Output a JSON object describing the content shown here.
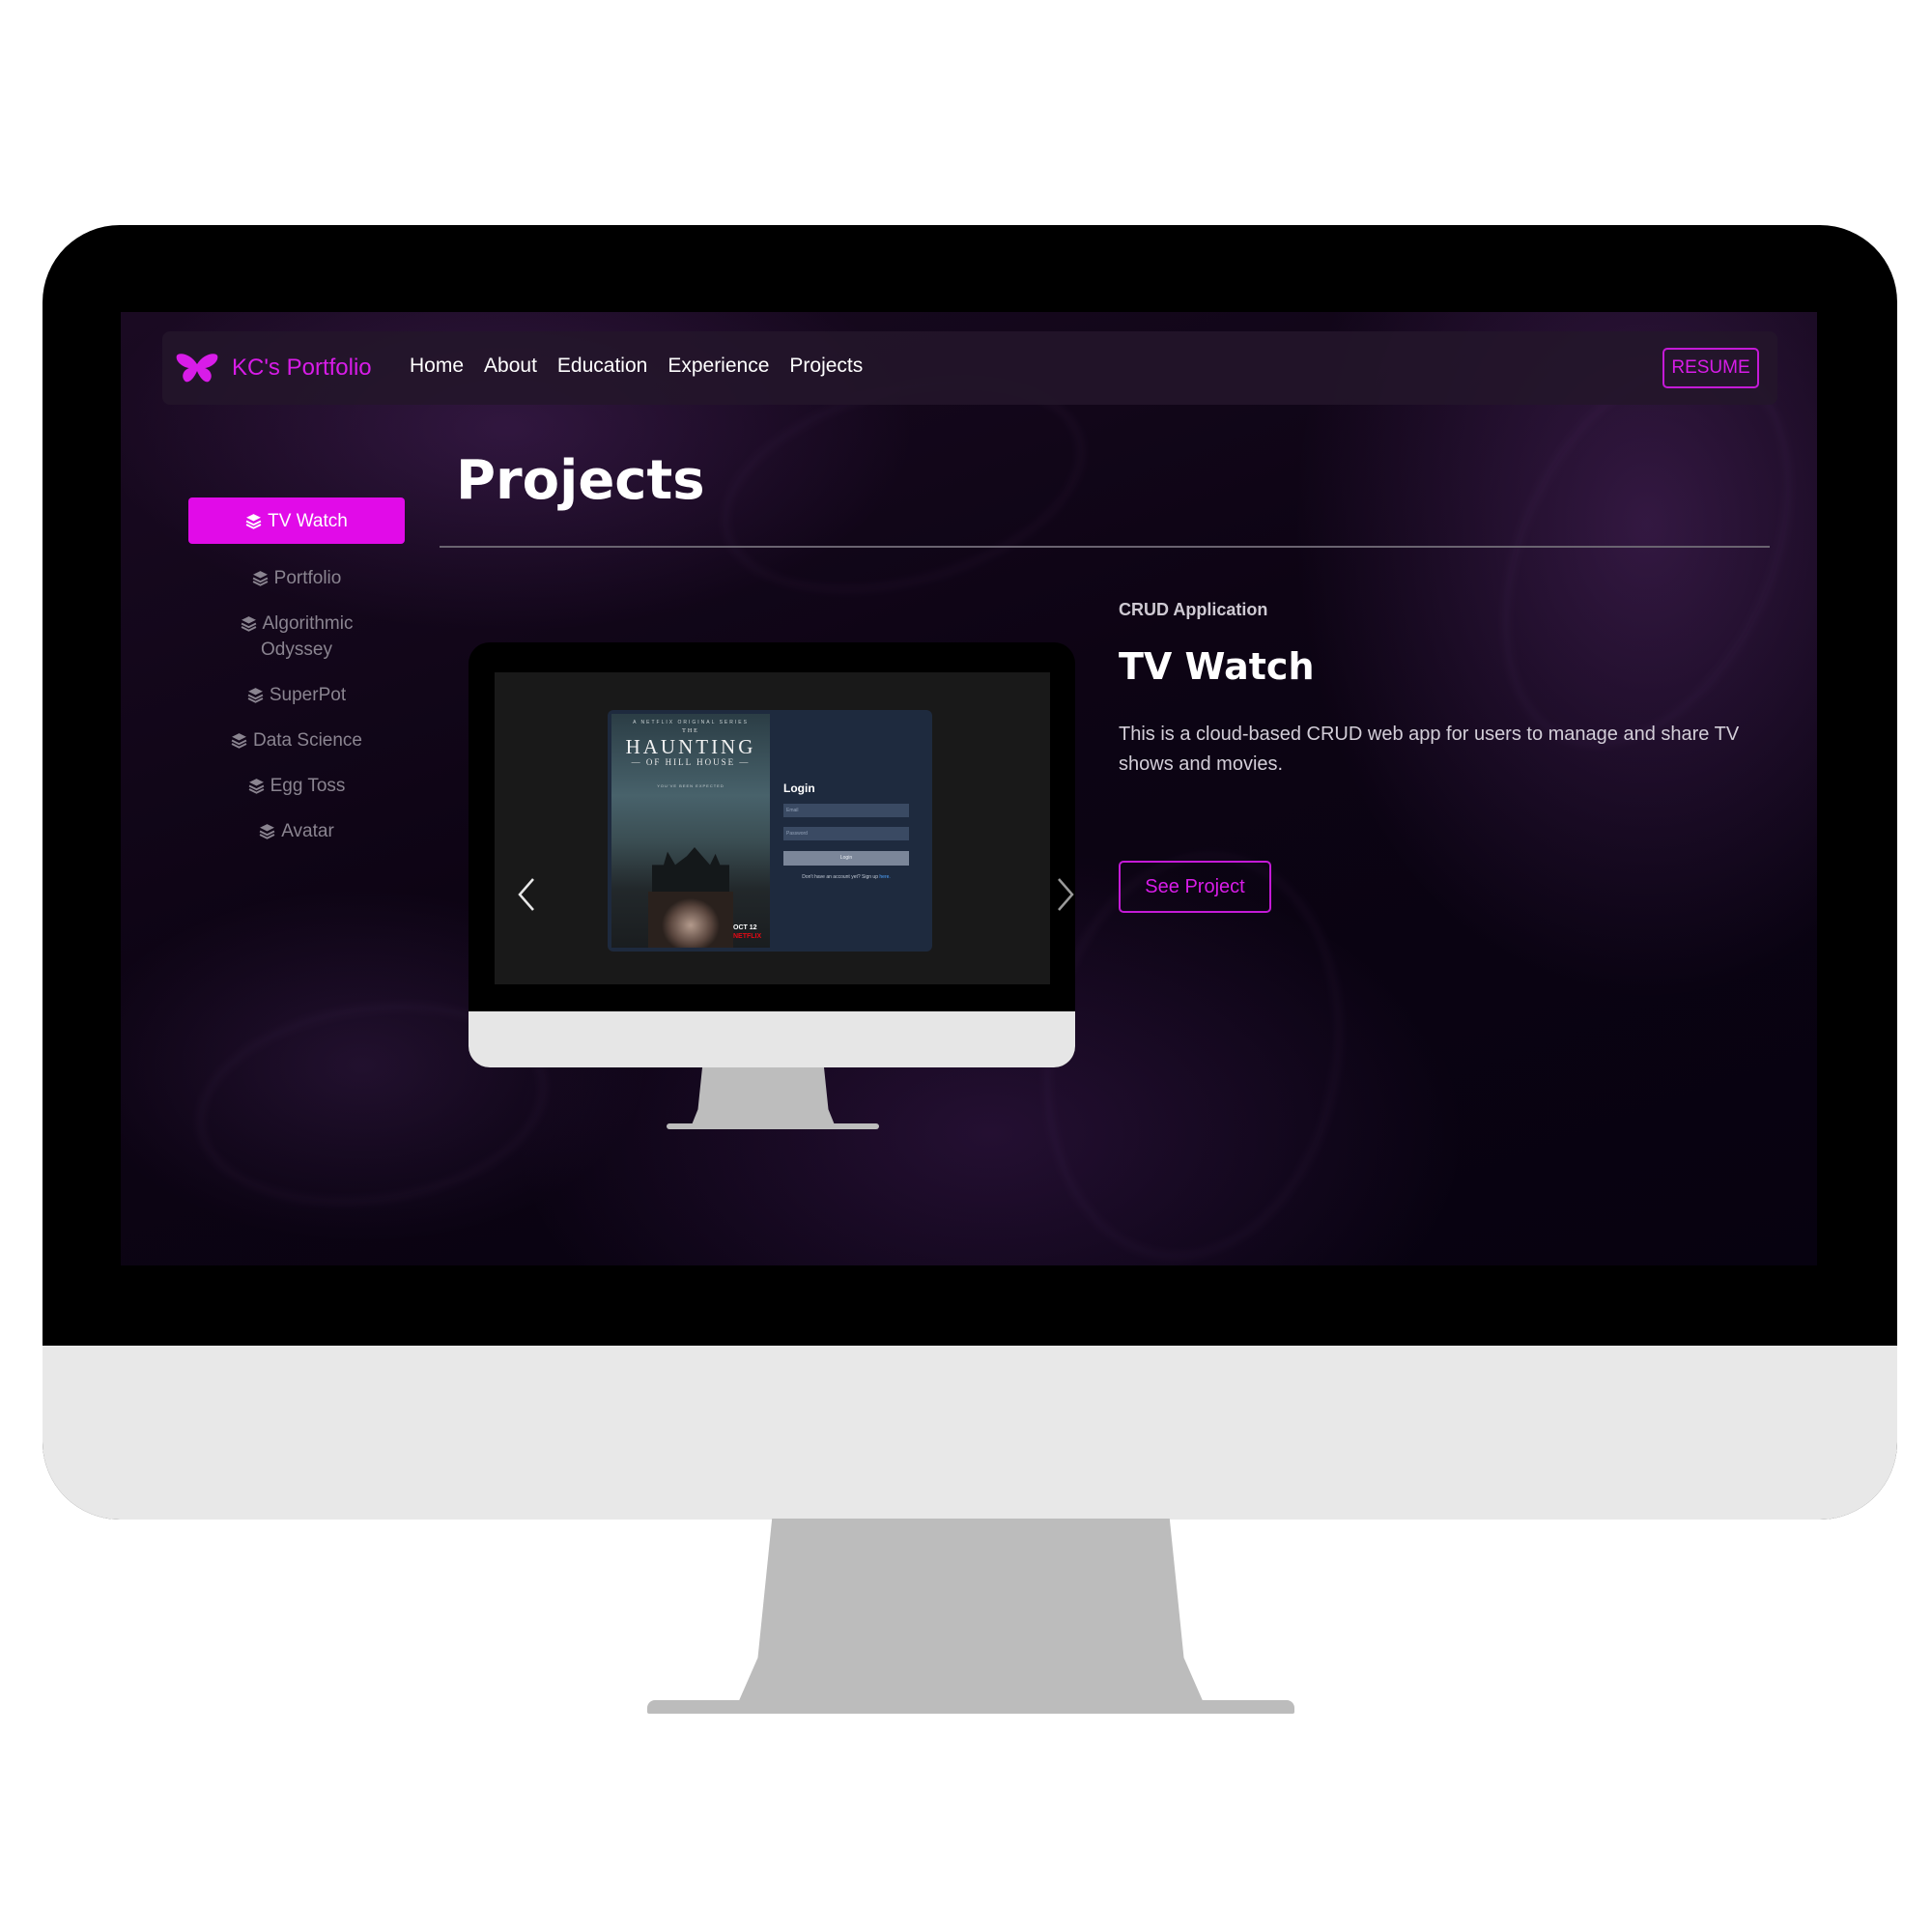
{
  "colors": {
    "accent": "#e10be8",
    "brand_text": "#d81ce8",
    "background": "#0d0414",
    "text": "#ffffff",
    "muted": "#8a8490"
  },
  "navbar": {
    "brand_icon": "butterfly-icon",
    "brand_name": "KC's Portfolio",
    "links": [
      "Home",
      "About",
      "Education",
      "Experience",
      "Projects"
    ],
    "resume_label": "RESUME"
  },
  "page": {
    "title": "Projects"
  },
  "sidebar": {
    "item_icon": "layers-icon",
    "items": [
      {
        "label": "TV Watch",
        "active": true
      },
      {
        "label": "Portfolio",
        "active": false
      },
      {
        "label_line1": "Algorithmic",
        "label_line2": "Odyssey",
        "active": false
      },
      {
        "label": "SuperPot",
        "active": false
      },
      {
        "label": "Data Science",
        "active": false
      },
      {
        "label": "Egg Toss",
        "active": false
      },
      {
        "label": "Avatar",
        "active": false
      }
    ]
  },
  "project": {
    "category": "CRUD Application",
    "title": "TV Watch",
    "description": "This is a cloud-based CRUD web app for users to manage and share TV shows and movies.",
    "button_label": "See Project"
  },
  "carousel": {
    "prev_icon": "chevron-left-icon",
    "next_icon": "chevron-right-icon",
    "slide": {
      "poster": {
        "series_line": "A NETFLIX ORIGINAL SERIES",
        "the": "THE",
        "title": "HAUNTING",
        "subtitle": "— OF HILL HOUSE —",
        "tagline": "YOU'VE BEEN EXPECTED",
        "date": "OCT 12",
        "brand": "NETFLIX"
      },
      "login": {
        "title": "Login",
        "email_placeholder": "Email",
        "password_placeholder": "Password",
        "button": "Login",
        "note": "Don't have an account yet? Sign up ",
        "note_link": "here."
      }
    }
  }
}
